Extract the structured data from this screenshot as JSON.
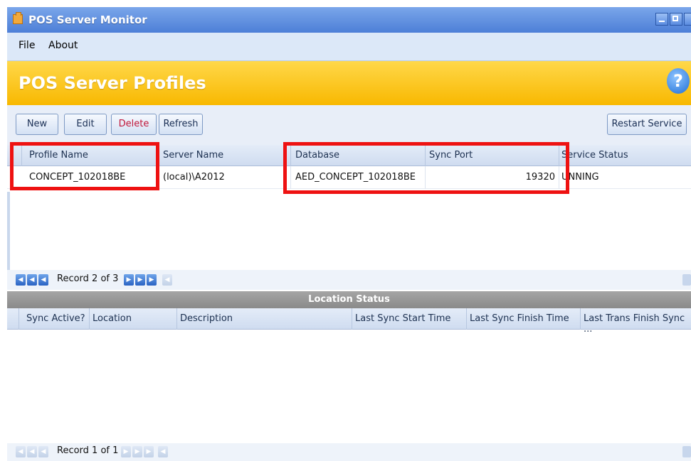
{
  "window": {
    "title": "POS Server Monitor"
  },
  "menu": {
    "file": "File",
    "about": "About"
  },
  "banner": {
    "title": "POS Server Profiles",
    "help": "?"
  },
  "toolbar": {
    "new": "New",
    "edit": "Edit",
    "delete": "Delete",
    "refresh": "Refresh",
    "restart": "Restart Service"
  },
  "profiles": {
    "columns": [
      "Profile Name",
      "Server Name",
      "Database",
      "Sync Port",
      "Service Status"
    ],
    "rows": [
      {
        "profile_name": "CONCEPT_102018BE",
        "server_name": "(local)\\A2012",
        "database": "AED_CONCEPT_102018BE",
        "sync_port": "19320",
        "service_status": "RUNNING"
      }
    ],
    "service_status_visible": "UNNING",
    "record_text": "Record 2 of 3"
  },
  "location": {
    "title": "Location Status",
    "columns": [
      "Sync Active?",
      "Location",
      "Description",
      "Last Sync Start Time",
      "Last Sync Finish Time",
      "Last Trans Finish Sync ..."
    ],
    "record_text": "Record 1 of 1"
  },
  "colors": {
    "banner": "#f8b800",
    "highlight": "#ee1111",
    "titlebar": "#4d7fd7"
  }
}
